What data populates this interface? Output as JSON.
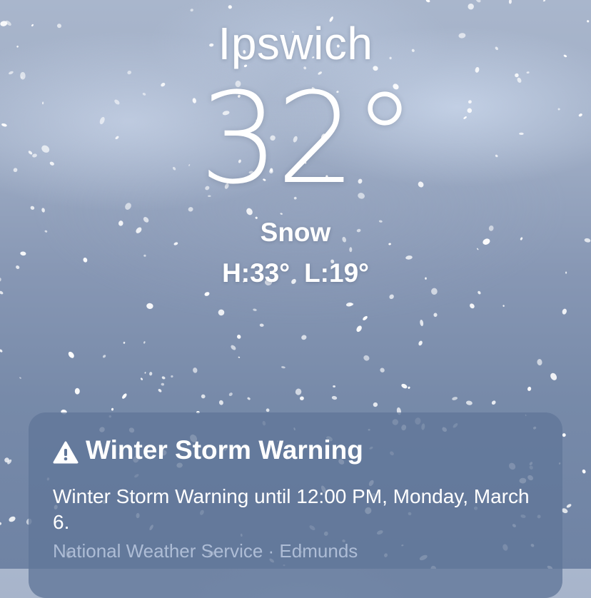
{
  "location": {
    "city": "Ipswich",
    "temperature": "32°",
    "condition": "Snow",
    "high": "H:33°",
    "low": "L:19°"
  },
  "alert": {
    "icon": "warning-triangle-icon",
    "title": "Winter Storm Warning",
    "description": "Winter Storm Warning until 12:00 PM, Monday, March 6.",
    "source": "National Weather Service · Edmunds"
  },
  "colors": {
    "sky_top": "#a9b6cc",
    "sky_bottom": "#6f83a4",
    "card_background": "#607698",
    "source_text": "#aebdd6"
  }
}
